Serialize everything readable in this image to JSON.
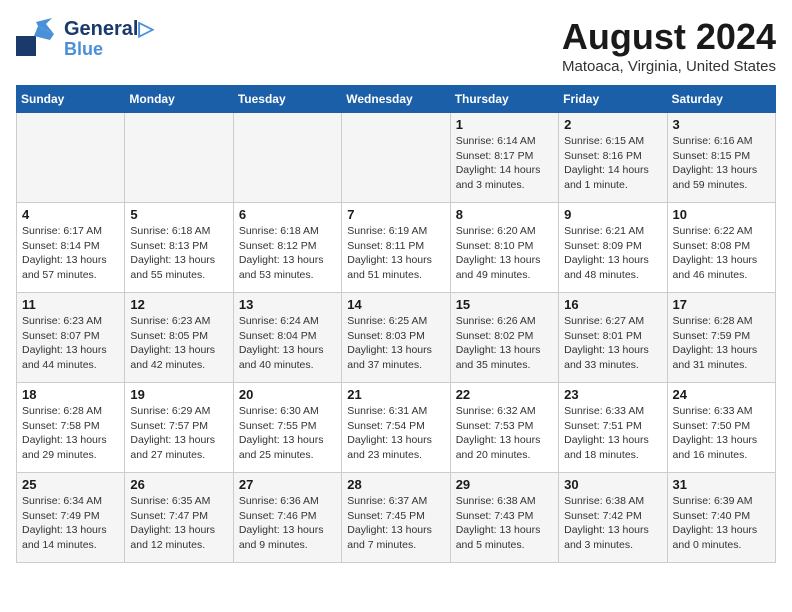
{
  "header": {
    "logo_line1": "General",
    "logo_line2": "Blue",
    "month_year": "August 2024",
    "location": "Matoaca, Virginia, United States"
  },
  "weekdays": [
    "Sunday",
    "Monday",
    "Tuesday",
    "Wednesday",
    "Thursday",
    "Friday",
    "Saturday"
  ],
  "weeks": [
    [
      {
        "day": "",
        "info": ""
      },
      {
        "day": "",
        "info": ""
      },
      {
        "day": "",
        "info": ""
      },
      {
        "day": "",
        "info": ""
      },
      {
        "day": "1",
        "info": "Sunrise: 6:14 AM\nSunset: 8:17 PM\nDaylight: 14 hours\nand 3 minutes."
      },
      {
        "day": "2",
        "info": "Sunrise: 6:15 AM\nSunset: 8:16 PM\nDaylight: 14 hours\nand 1 minute."
      },
      {
        "day": "3",
        "info": "Sunrise: 6:16 AM\nSunset: 8:15 PM\nDaylight: 13 hours\nand 59 minutes."
      }
    ],
    [
      {
        "day": "4",
        "info": "Sunrise: 6:17 AM\nSunset: 8:14 PM\nDaylight: 13 hours\nand 57 minutes."
      },
      {
        "day": "5",
        "info": "Sunrise: 6:18 AM\nSunset: 8:13 PM\nDaylight: 13 hours\nand 55 minutes."
      },
      {
        "day": "6",
        "info": "Sunrise: 6:18 AM\nSunset: 8:12 PM\nDaylight: 13 hours\nand 53 minutes."
      },
      {
        "day": "7",
        "info": "Sunrise: 6:19 AM\nSunset: 8:11 PM\nDaylight: 13 hours\nand 51 minutes."
      },
      {
        "day": "8",
        "info": "Sunrise: 6:20 AM\nSunset: 8:10 PM\nDaylight: 13 hours\nand 49 minutes."
      },
      {
        "day": "9",
        "info": "Sunrise: 6:21 AM\nSunset: 8:09 PM\nDaylight: 13 hours\nand 48 minutes."
      },
      {
        "day": "10",
        "info": "Sunrise: 6:22 AM\nSunset: 8:08 PM\nDaylight: 13 hours\nand 46 minutes."
      }
    ],
    [
      {
        "day": "11",
        "info": "Sunrise: 6:23 AM\nSunset: 8:07 PM\nDaylight: 13 hours\nand 44 minutes."
      },
      {
        "day": "12",
        "info": "Sunrise: 6:23 AM\nSunset: 8:05 PM\nDaylight: 13 hours\nand 42 minutes."
      },
      {
        "day": "13",
        "info": "Sunrise: 6:24 AM\nSunset: 8:04 PM\nDaylight: 13 hours\nand 40 minutes."
      },
      {
        "day": "14",
        "info": "Sunrise: 6:25 AM\nSunset: 8:03 PM\nDaylight: 13 hours\nand 37 minutes."
      },
      {
        "day": "15",
        "info": "Sunrise: 6:26 AM\nSunset: 8:02 PM\nDaylight: 13 hours\nand 35 minutes."
      },
      {
        "day": "16",
        "info": "Sunrise: 6:27 AM\nSunset: 8:01 PM\nDaylight: 13 hours\nand 33 minutes."
      },
      {
        "day": "17",
        "info": "Sunrise: 6:28 AM\nSunset: 7:59 PM\nDaylight: 13 hours\nand 31 minutes."
      }
    ],
    [
      {
        "day": "18",
        "info": "Sunrise: 6:28 AM\nSunset: 7:58 PM\nDaylight: 13 hours\nand 29 minutes."
      },
      {
        "day": "19",
        "info": "Sunrise: 6:29 AM\nSunset: 7:57 PM\nDaylight: 13 hours\nand 27 minutes."
      },
      {
        "day": "20",
        "info": "Sunrise: 6:30 AM\nSunset: 7:55 PM\nDaylight: 13 hours\nand 25 minutes."
      },
      {
        "day": "21",
        "info": "Sunrise: 6:31 AM\nSunset: 7:54 PM\nDaylight: 13 hours\nand 23 minutes."
      },
      {
        "day": "22",
        "info": "Sunrise: 6:32 AM\nSunset: 7:53 PM\nDaylight: 13 hours\nand 20 minutes."
      },
      {
        "day": "23",
        "info": "Sunrise: 6:33 AM\nSunset: 7:51 PM\nDaylight: 13 hours\nand 18 minutes."
      },
      {
        "day": "24",
        "info": "Sunrise: 6:33 AM\nSunset: 7:50 PM\nDaylight: 13 hours\nand 16 minutes."
      }
    ],
    [
      {
        "day": "25",
        "info": "Sunrise: 6:34 AM\nSunset: 7:49 PM\nDaylight: 13 hours\nand 14 minutes."
      },
      {
        "day": "26",
        "info": "Sunrise: 6:35 AM\nSunset: 7:47 PM\nDaylight: 13 hours\nand 12 minutes."
      },
      {
        "day": "27",
        "info": "Sunrise: 6:36 AM\nSunset: 7:46 PM\nDaylight: 13 hours\nand 9 minutes."
      },
      {
        "day": "28",
        "info": "Sunrise: 6:37 AM\nSunset: 7:45 PM\nDaylight: 13 hours\nand 7 minutes."
      },
      {
        "day": "29",
        "info": "Sunrise: 6:38 AM\nSunset: 7:43 PM\nDaylight: 13 hours\nand 5 minutes."
      },
      {
        "day": "30",
        "info": "Sunrise: 6:38 AM\nSunset: 7:42 PM\nDaylight: 13 hours\nand 3 minutes."
      },
      {
        "day": "31",
        "info": "Sunrise: 6:39 AM\nSunset: 7:40 PM\nDaylight: 13 hours\nand 0 minutes."
      }
    ]
  ]
}
